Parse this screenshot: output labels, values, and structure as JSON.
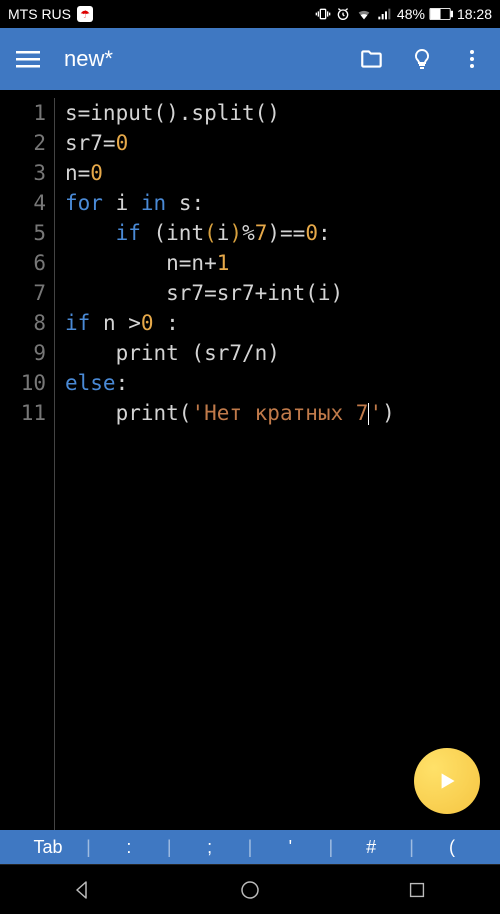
{
  "status": {
    "carrier": "MTS RUS",
    "battery": "48%",
    "time": "18:28"
  },
  "app": {
    "title": "new*"
  },
  "code": {
    "lines": [
      [
        {
          "t": "s=input().split()",
          "c": ""
        }
      ],
      [
        {
          "t": "sr7=",
          "c": ""
        },
        {
          "t": "0",
          "c": "tok-num"
        }
      ],
      [
        {
          "t": "n=",
          "c": ""
        },
        {
          "t": "0",
          "c": "tok-num"
        }
      ],
      [
        {
          "t": "for",
          "c": "tok-kw"
        },
        {
          "t": " i ",
          "c": ""
        },
        {
          "t": "in",
          "c": "tok-kw"
        },
        {
          "t": " s:",
          "c": ""
        }
      ],
      [
        {
          "t": "    ",
          "c": ""
        },
        {
          "t": "if",
          "c": "tok-kw"
        },
        {
          "t": " (int",
          "c": ""
        },
        {
          "t": "(",
          "c": "tok-paren-active"
        },
        {
          "t": "i",
          "c": ""
        },
        {
          "t": ")",
          "c": "tok-paren-active"
        },
        {
          "t": "%",
          "c": ""
        },
        {
          "t": "7",
          "c": "tok-num"
        },
        {
          "t": ")==",
          "c": ""
        },
        {
          "t": "0",
          "c": "tok-num"
        },
        {
          "t": ":",
          "c": ""
        }
      ],
      [
        {
          "t": "        n=n+",
          "c": ""
        },
        {
          "t": "1",
          "c": "tok-num"
        }
      ],
      [
        {
          "t": "        sr7=sr7+int(i)",
          "c": ""
        }
      ],
      [
        {
          "t": "if",
          "c": "tok-kw"
        },
        {
          "t": " n >",
          "c": ""
        },
        {
          "t": "0",
          "c": "tok-num"
        },
        {
          "t": " :",
          "c": ""
        }
      ],
      [
        {
          "t": "    print (sr7/n)",
          "c": ""
        }
      ],
      [
        {
          "t": "else",
          "c": "tok-kw"
        },
        {
          "t": ":",
          "c": ""
        }
      ],
      [
        {
          "t": "    print(",
          "c": ""
        },
        {
          "t": "'Нет кратных 7",
          "c": "tok-str"
        },
        {
          "t": "",
          "c": "cursor"
        },
        {
          "t": "'",
          "c": "tok-str"
        },
        {
          "t": ")",
          "c": ""
        }
      ]
    ]
  },
  "toolbar": {
    "tab_label": "Tab",
    "keys": [
      ":",
      ";",
      "'",
      "#",
      "("
    ]
  }
}
